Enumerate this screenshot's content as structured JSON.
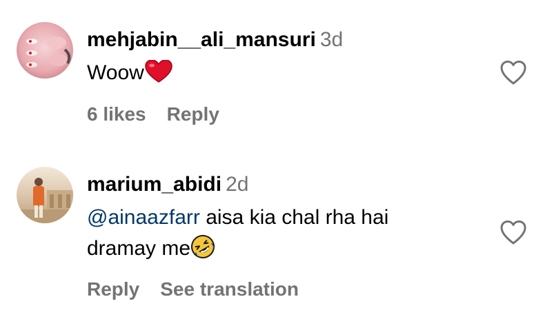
{
  "comments": [
    {
      "username": "mehjabin__ali_mansuri",
      "time": "3d",
      "text": "Woow",
      "text_emoji": "red-heart",
      "likes": "6 likes",
      "reply": "Reply"
    },
    {
      "username": "marium_abidi",
      "time": "2d",
      "mention": "@ainaazfarr",
      "text_line1": " aisa kia chal rha hai",
      "text_line2": "dramay me",
      "text_emoji": "rolling-on-floor-laughing",
      "reply": "Reply",
      "translate": "See translation"
    }
  ],
  "colors": {
    "secondary_text": "#737373",
    "mention": "#00376b",
    "heart_emoji": "#e0102a",
    "laugh_emoji": "#f6c53a"
  }
}
